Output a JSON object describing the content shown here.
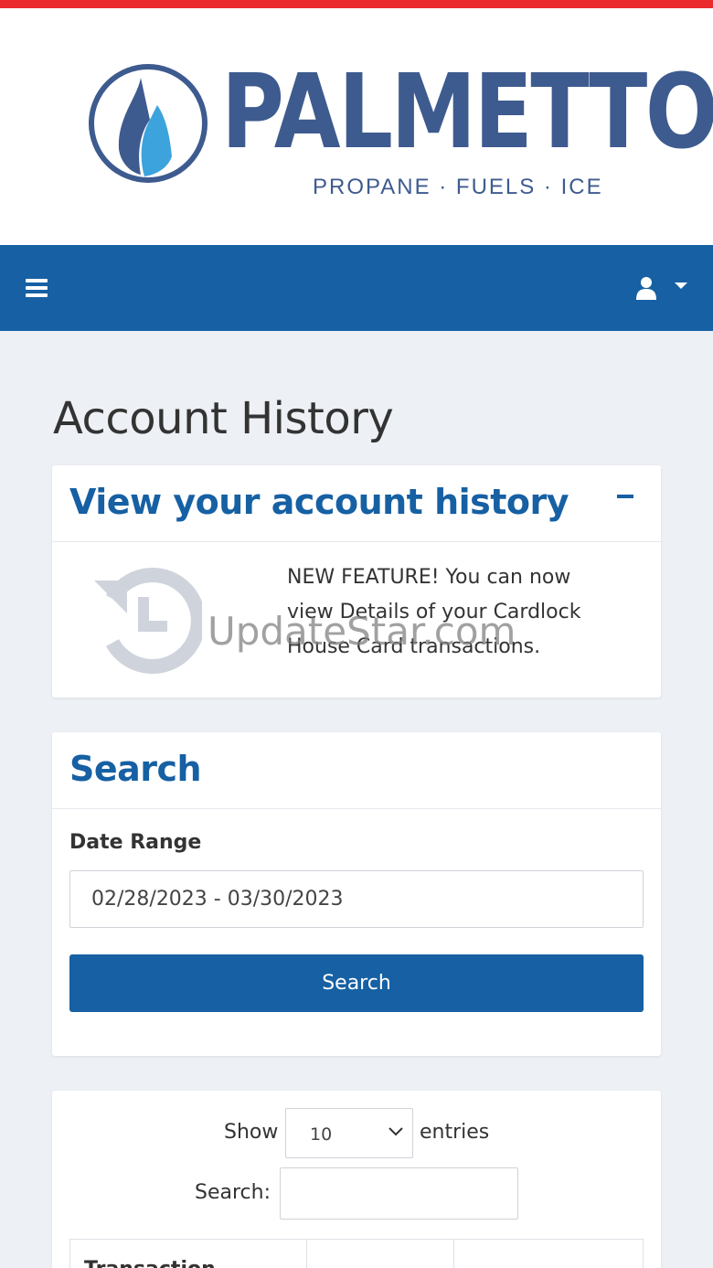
{
  "brand": {
    "name": "PALMETTO",
    "tagline": "PROPANE · FUELS · ICE",
    "primary_color": "#1660a3",
    "logo_color": "#3e5b8f",
    "stripe_color": "#ea2a2d"
  },
  "navbar": {
    "menu_icon": "hamburger-icon",
    "user_icon": "user-icon"
  },
  "page": {
    "title": "Account History"
  },
  "history_card": {
    "title": "View your account history",
    "collapse_icon": "minus-icon",
    "icon": "history-icon",
    "feature_text": "NEW FEATURE! You can now view Details of your Cardlock House Card transactions.",
    "watermark": "UpdateStar.com"
  },
  "search_card": {
    "title": "Search",
    "date_range_label": "Date Range",
    "date_range_value": "02/28/2023 - 03/30/2023",
    "button_label": "Search"
  },
  "table_card": {
    "show_label": "Show",
    "entries_value": "10",
    "entries_label": "entries",
    "filter_label": "Search:",
    "filter_value": "",
    "columns": [
      "Transaction",
      "",
      ""
    ]
  }
}
